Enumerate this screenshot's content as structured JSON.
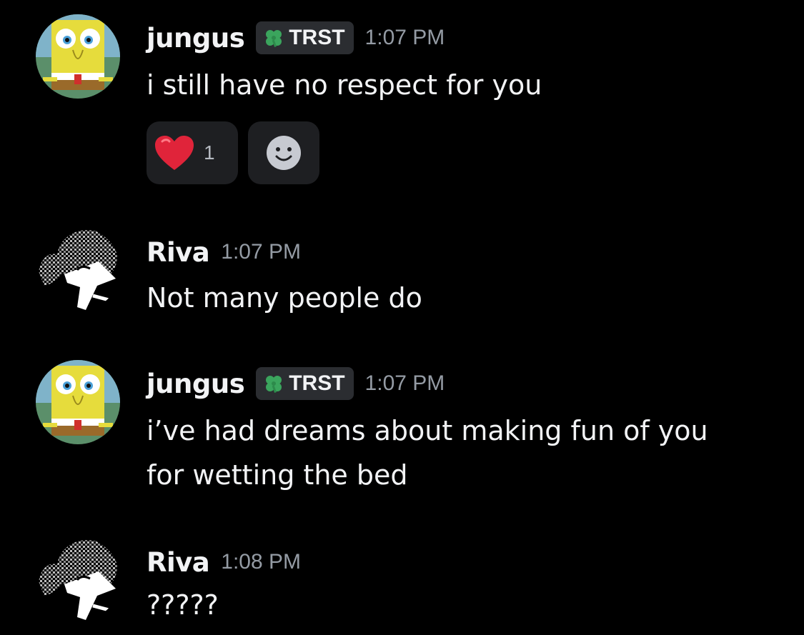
{
  "messages": [
    {
      "author": "jungus",
      "tag": "TRST",
      "timestamp": "1:07 PM",
      "lines": [
        "i still have no respect for you"
      ],
      "reactions": [
        {
          "emoji": "heart-icon",
          "count": "1"
        }
      ]
    },
    {
      "author": "Riva",
      "timestamp": "1:07 PM",
      "lines": [
        "Not many people do"
      ]
    },
    {
      "author": "jungus",
      "tag": "TRST",
      "timestamp": "1:07 PM",
      "lines": [
        "i’ve had dreams about making fun of you",
        "for wetting the bed"
      ]
    },
    {
      "author": "Riva",
      "timestamp": "1:08 PM",
      "lines": [
        "?????"
      ]
    }
  ],
  "colors": {
    "background": "#000000",
    "username": "#f2f3f5",
    "timestamp": "#949ba4",
    "tag_bg": "#2b2d31",
    "reaction_bg": "#1e1f22",
    "clover": "#3ba55d",
    "heart": "#e0243a"
  }
}
